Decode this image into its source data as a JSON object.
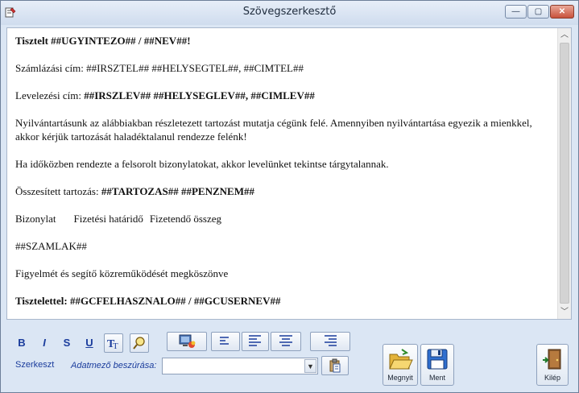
{
  "window": {
    "title": "Szövegszerkesztő",
    "controls": {
      "minimize": "—",
      "maximize": "▢",
      "close": "✕"
    }
  },
  "document": {
    "greeting": {
      "prefix": "Tisztelt ",
      "placeholder": "##UGYINTEZO## / ##NEV##!"
    },
    "billing": "Számlázási cím: ##IRSZTEL## ##HELYSEGTEL##, ##CIMTEL##",
    "mailing": {
      "prefix": "Levelezési cím: ",
      "placeholder": "##IRSZLEV## ##HELYSEGLEV##, ##CIMLEV##"
    },
    "paragraph1": "Nyilvántartásunk az alábbiakban részletezett tartozást mutatja cégünk felé. Amennyiben nyilvántartása egyezik a mienkkel, akkor kérjük tartozását haladéktalanul rendezze felénk!",
    "paragraph2": "Ha időközben rendezte a felsorolt bizonylatokat, akkor levelünket tekintse tárgytalannak.",
    "total": {
      "prefix": "Összesített tartozás: ",
      "placeholder": "##TARTOZAS## ##PENZNEM##"
    },
    "columns": [
      "Bizonylat",
      "Fizetési határidő",
      "Fizetendő összeg"
    ],
    "invoices": "##SZAMLAK##",
    "thanks": "Figyelmét és segítő közreműködését megköszönve",
    "signature": "Tisztelettel: ##GCFELHASZNALO## / ##GCUSERNEV##"
  },
  "toolbar": {
    "bold": "B",
    "italic": "I",
    "strike": "S",
    "underline": "U",
    "edit_label": "Szerkeszt",
    "insert_label": "Adatmező beszúrása:",
    "insert_value": "",
    "open_label": "Megnyit",
    "save_label": "Ment",
    "exit_label": "Kilép"
  },
  "icons": {
    "font": "font-icon",
    "find": "find-icon",
    "color": "color-icon",
    "align_left": "align-left-icon",
    "align_left2": "align-justify-left-icon",
    "align_center": "align-center-icon",
    "align_right": "align-right-icon",
    "paste": "paste-icon",
    "open": "folder-open-icon",
    "save": "floppy-disk-icon",
    "exit": "exit-door-icon"
  }
}
